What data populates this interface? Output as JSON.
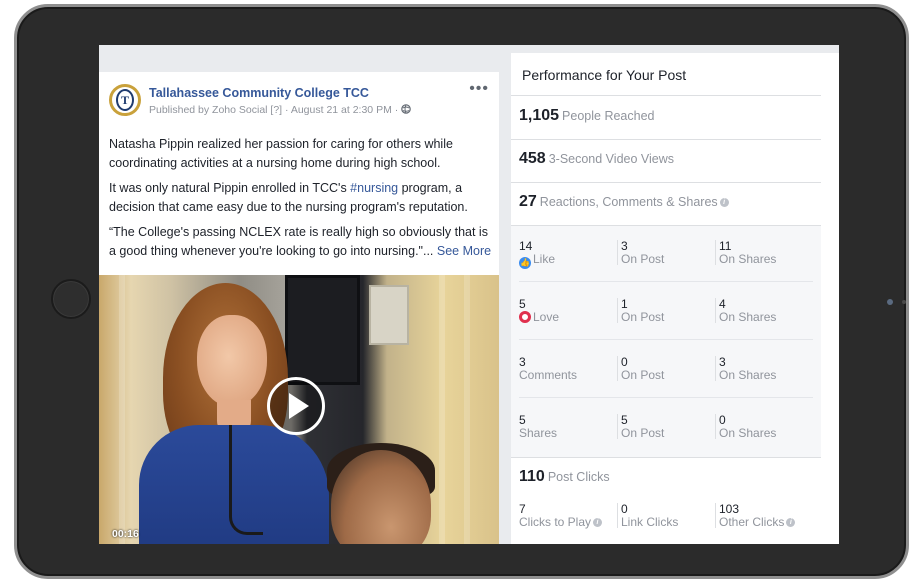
{
  "post": {
    "page_name": "Tallahassee Community College TCC",
    "logo_letter": "T",
    "meta": "Published by Zoho Social [?] · August 21 at 2:30 PM · ",
    "globe_icon": "globe-icon",
    "more_icon": "more-options-icon",
    "paragraph1": "Natasha Pippin realized her passion for caring for others while coordinating activities at a nursing home during high school.",
    "paragraph2_pre": "It was only natural Pippin enrolled in TCC's ",
    "hashtag": "#nursing",
    "paragraph2_post": " program, a decision that came easy due to the nursing program's reputation.",
    "paragraph3": "“The College's passing NCLEX rate is really high so obviously that is a good thing whenever you're looking to go into nursing.\"... ",
    "see_more": "See More",
    "video_duration": "00:16",
    "play_icon": "play-icon"
  },
  "performance": {
    "title": "Performance for Your Post",
    "reached": {
      "value": "1,105",
      "label": "People Reached"
    },
    "video_views": {
      "value": "458",
      "label": "3-Second Video Views"
    },
    "engagement": {
      "value": "27",
      "label": "Reactions, Comments & Shares"
    },
    "breakdown": [
      {
        "total": "14",
        "label": "Like",
        "icon": "like-icon",
        "on_post": "3",
        "on_post_label": "On Post",
        "on_shares": "11",
        "on_shares_label": "On Shares"
      },
      {
        "total": "5",
        "label": "Love",
        "icon": "love-icon",
        "on_post": "1",
        "on_post_label": "On Post",
        "on_shares": "4",
        "on_shares_label": "On Shares"
      },
      {
        "total": "3",
        "label": "Comments",
        "on_post": "0",
        "on_post_label": "On Post",
        "on_shares": "3",
        "on_shares_label": "On Shares"
      },
      {
        "total": "5",
        "label": "Shares",
        "on_post": "5",
        "on_post_label": "On Post",
        "on_shares": "0",
        "on_shares_label": "On Shares"
      }
    ],
    "post_clicks": {
      "value": "110",
      "label": "Post Clicks"
    },
    "clicks": [
      {
        "value": "7",
        "label": "Clicks to Play"
      },
      {
        "value": "0",
        "label": "Link Clicks"
      },
      {
        "value": "103",
        "label": "Other Clicks"
      }
    ],
    "info_glyph": "i"
  },
  "colors": {
    "link": "#365899",
    "like": "#3b8df0",
    "love": "#e0304e",
    "muted": "#90949c"
  }
}
